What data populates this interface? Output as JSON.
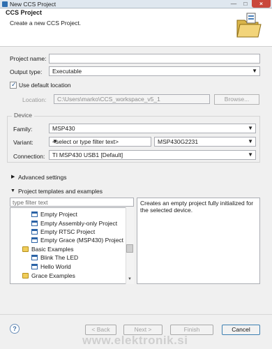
{
  "window": {
    "title": "New CCS Project"
  },
  "banner": {
    "title": "CCS Project",
    "description": "Create a new CCS Project."
  },
  "form": {
    "project_name_label": "Project name:",
    "project_name_value": "",
    "output_type_label": "Output type:",
    "output_type_value": "Executable",
    "use_default_location_label": "Use default location",
    "use_default_location_checked": true,
    "location_label": "Location:",
    "location_value": "C:\\Users\\marko\\CCS_workspace_v5_1",
    "browse_label": "Browse..."
  },
  "device": {
    "group_label": "Device",
    "family_label": "Family:",
    "family_value": "MSP430",
    "variant_label": "Variant:",
    "variant_filter_placeholder": "<select or type filter text>",
    "variant_value": "MSP430G2231",
    "connection_label": "Connection:",
    "connection_value": "TI MSP430 USB1 [Default]"
  },
  "sections": {
    "advanced_label": "Advanced settings",
    "templates_label": "Project templates and examples"
  },
  "templates": {
    "filter_placeholder": "type filter text",
    "items": [
      {
        "label": "Empty Project",
        "kind": "project"
      },
      {
        "label": "Empty Assembly-only Project",
        "kind": "project"
      },
      {
        "label": "Empty RTSC Project",
        "kind": "project"
      },
      {
        "label": "Empty Grace (MSP430) Project",
        "kind": "project"
      },
      {
        "label": "Basic Examples",
        "kind": "folder"
      },
      {
        "label": "Blink The LED",
        "kind": "project"
      },
      {
        "label": "Hello World",
        "kind": "project"
      },
      {
        "label": "Grace Examples",
        "kind": "folder"
      }
    ],
    "description": "Creates an empty project fully initialized for the selected device."
  },
  "buttons": {
    "help": "?",
    "back": "< Back",
    "next": "Next >",
    "finish": "Finish",
    "cancel": "Cancel"
  },
  "watermark": "www.elektronik.si"
}
